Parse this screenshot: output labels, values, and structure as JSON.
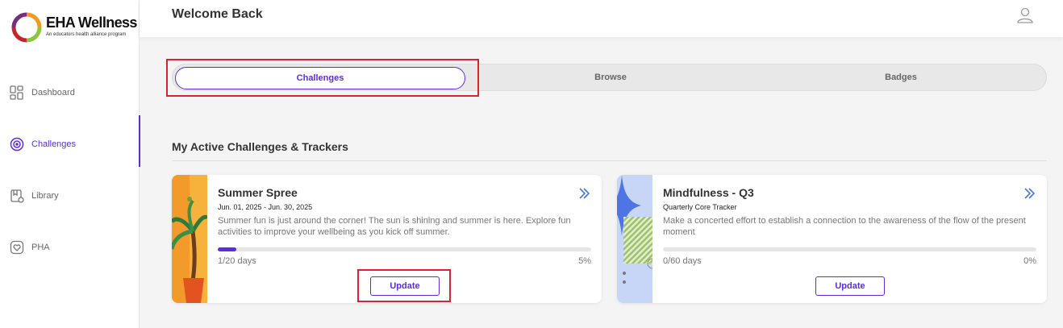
{
  "brand": {
    "name": "EHA Wellness",
    "tagline": "An educators health alliance program"
  },
  "sidebar": {
    "items": [
      {
        "label": "Dashboard",
        "icon": "dashboard-icon",
        "active": false
      },
      {
        "label": "Challenges",
        "icon": "target-icon",
        "active": true
      },
      {
        "label": "Library",
        "icon": "library-icon",
        "active": false
      },
      {
        "label": "PHA",
        "icon": "heart-icon",
        "active": false
      }
    ]
  },
  "header": {
    "title": "Welcome Back",
    "user_icon": "user-icon"
  },
  "tabs": [
    {
      "label": "Challenges",
      "active": true
    },
    {
      "label": "Browse",
      "active": false
    },
    {
      "label": "Badges",
      "active": false
    }
  ],
  "section": {
    "title": "My Active Challenges & Trackers"
  },
  "cards": [
    {
      "title": "Summer Spree",
      "subtitle": "Jun. 01, 2025 - Jun. 30, 2025",
      "description": "Summer fun is just around the corner! The sun is shining and summer is here. Explore fun activities to improve your wellbeing as you kick off summer.",
      "progress_text": "1/20 days",
      "percent_text": "5%",
      "progress": 0.05,
      "button": "Update"
    },
    {
      "title": "Mindfulness - Q3",
      "subtitle": "Quarterly Core Tracker",
      "description": "Make a concerted effort to establish a connection to the awareness of the flow of the present moment",
      "progress_text": "0/60 days",
      "percent_text": "0%",
      "progress": 0,
      "button": "Update"
    }
  ],
  "colors": {
    "accent": "#5a2ee0",
    "highlight": "#d9232e",
    "background": "#f4f4f4"
  }
}
